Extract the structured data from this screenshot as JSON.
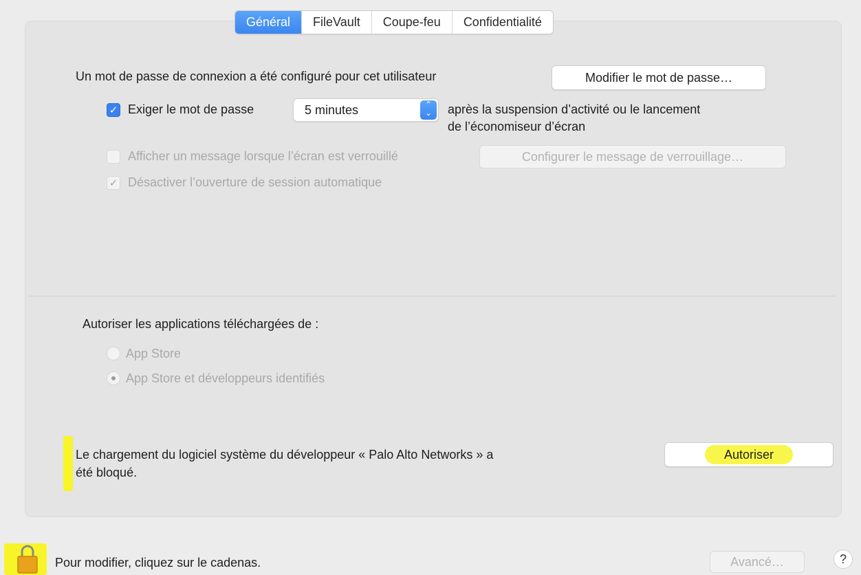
{
  "tabs": [
    {
      "label": "Général",
      "active": true
    },
    {
      "label": "FileVault",
      "active": false
    },
    {
      "label": "Coupe-feu",
      "active": false
    },
    {
      "label": "Confidentialité",
      "active": false
    }
  ],
  "general": {
    "password_status": "Un mot de passe de connexion a été configuré pour cet utilisateur",
    "change_password_button": "Modifier le mot de passe…",
    "require_password": {
      "label": "Exiger le mot de passe",
      "checked": true,
      "delay_value": "5 minutes",
      "after_text_line1": "après la suspension d’activité ou le lancement",
      "after_text_line2": "de l’économiseur d’écran"
    },
    "show_message": {
      "label": "Afficher un message lorsque l’écran est verrouillé",
      "checked": false,
      "enabled": false,
      "button": "Configurer le message de verrouillage…"
    },
    "disable_auto_login": {
      "label": "Désactiver l’ouverture de session automatique",
      "checked": true,
      "enabled": false
    }
  },
  "downloads": {
    "heading": "Autoriser les applications téléchargées de :",
    "options": [
      {
        "label": "App Store",
        "selected": false
      },
      {
        "label": "App Store et développeurs identifiés",
        "selected": true
      }
    ]
  },
  "blocked": {
    "line1": "Le chargement du logiciel système du développeur « Palo Alto Networks » a",
    "line2": "été bloqué.",
    "allow_button": "Autoriser"
  },
  "footer": {
    "lock_text": "Pour modifier, cliquez sur le cadenas.",
    "advanced_button": "Avancé…",
    "help_label": "?"
  },
  "colors": {
    "accent": "#3a82f0",
    "highlight": "#f7f52a",
    "panel": "#e4e4e4",
    "background": "#ececec"
  },
  "icons": [
    "lock-icon",
    "checkmark-icon",
    "stepper-icon",
    "help-icon"
  ]
}
